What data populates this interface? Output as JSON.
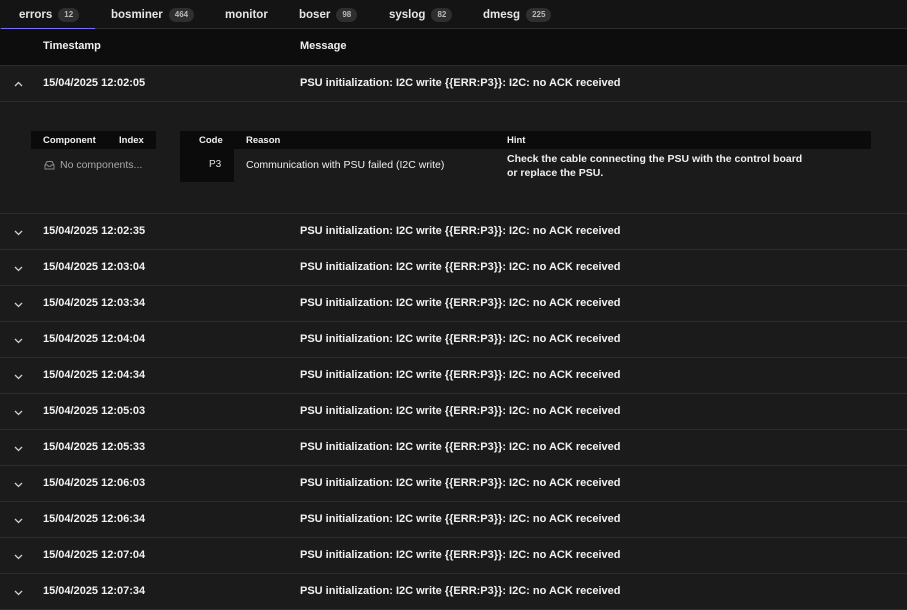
{
  "tabs": [
    {
      "label": "errors",
      "count": "12",
      "active": true
    },
    {
      "label": "bosminer",
      "count": "464"
    },
    {
      "label": "monitor",
      "count": ""
    },
    {
      "label": "boser",
      "count": "98"
    },
    {
      "label": "syslog",
      "count": "82"
    },
    {
      "label": "dmesg",
      "count": "225"
    }
  ],
  "table": {
    "col_timestamp": "Timestamp",
    "col_message": "Message"
  },
  "expanded": {
    "timestamp": "15/04/2025 12:02:05",
    "message": "PSU initialization: I2C write {{ERR:P3}}: I2C: no ACK received",
    "components": {
      "col_component": "Component",
      "col_index": "Index",
      "empty": "No components..."
    },
    "error": {
      "col_code": "Code",
      "col_reason": "Reason",
      "col_hint": "Hint",
      "code": "P3",
      "reason": "Communication with PSU failed (I2C write)",
      "hint": "Check the cable connecting the PSU with the control board or replace the PSU."
    }
  },
  "rows": [
    {
      "timestamp": "15/04/2025 12:02:35",
      "message": "PSU initialization: I2C write {{ERR:P3}}: I2C: no ACK received"
    },
    {
      "timestamp": "15/04/2025 12:03:04",
      "message": "PSU initialization: I2C write {{ERR:P3}}: I2C: no ACK received"
    },
    {
      "timestamp": "15/04/2025 12:03:34",
      "message": "PSU initialization: I2C write {{ERR:P3}}: I2C: no ACK received"
    },
    {
      "timestamp": "15/04/2025 12:04:04",
      "message": "PSU initialization: I2C write {{ERR:P3}}: I2C: no ACK received"
    },
    {
      "timestamp": "15/04/2025 12:04:34",
      "message": "PSU initialization: I2C write {{ERR:P3}}: I2C: no ACK received"
    },
    {
      "timestamp": "15/04/2025 12:05:03",
      "message": "PSU initialization: I2C write {{ERR:P3}}: I2C: no ACK received"
    },
    {
      "timestamp": "15/04/2025 12:05:33",
      "message": "PSU initialization: I2C write {{ERR:P3}}: I2C: no ACK received"
    },
    {
      "timestamp": "15/04/2025 12:06:03",
      "message": "PSU initialization: I2C write {{ERR:P3}}: I2C: no ACK received"
    },
    {
      "timestamp": "15/04/2025 12:06:34",
      "message": "PSU initialization: I2C write {{ERR:P3}}: I2C: no ACK received"
    },
    {
      "timestamp": "15/04/2025 12:07:04",
      "message": "PSU initialization: I2C write {{ERR:P3}}: I2C: no ACK received"
    },
    {
      "timestamp": "15/04/2025 12:07:34",
      "message": "PSU initialization: I2C write {{ERR:P3}}: I2C: no ACK received"
    }
  ],
  "colors": {
    "accent": "#7a6cff",
    "background": "#1b1b1b",
    "header_bg": "#0d0d0d"
  },
  "icons": {
    "expanded": "chevron-up-icon",
    "collapsed": "chevron-down-icon",
    "empty": "inbox-icon"
  }
}
